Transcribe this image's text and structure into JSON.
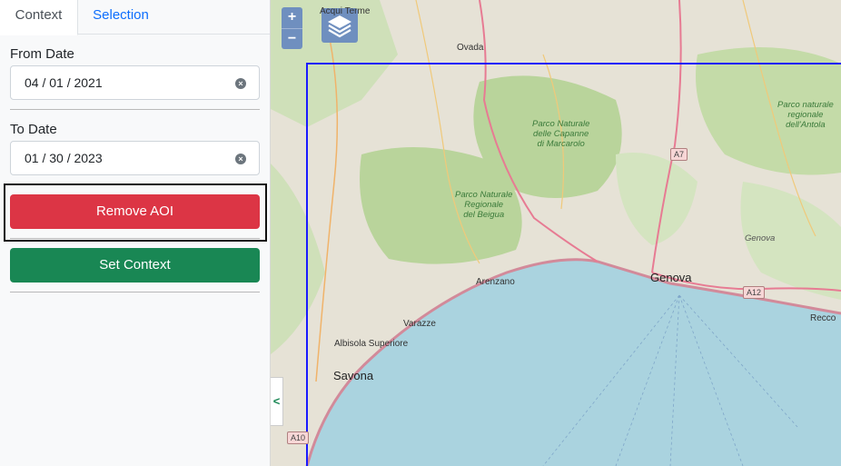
{
  "tabs": [
    {
      "label": "Context",
      "active": true
    },
    {
      "label": "Selection",
      "active": false
    }
  ],
  "from_date": {
    "label": "From Date",
    "value": "04 / 01 / 2021"
  },
  "to_date": {
    "label": "To Date",
    "value": "01 / 30 / 2023"
  },
  "buttons": {
    "remove_aoi": "Remove AOI",
    "set_context": "Set Context"
  },
  "map": {
    "zoom_in": "+",
    "zoom_out": "−",
    "collapse": "<",
    "labels": {
      "acqui_terme": "Acqui Terme",
      "ovada": "Ovada",
      "park_capanne": "Parco Naturale\ndelle Capanne\ndi Marcarolo",
      "park_beigua": "Parco Naturale\nRegionale\ndel Beigua",
      "park_antola": "Parco naturale\nregionale\ndell'Antola",
      "a7": "A7",
      "a12": "A12",
      "a10": "A10",
      "genova_small": "Genova",
      "genova": "Genova",
      "arenzano": "Arenzano",
      "varazze": "Varazze",
      "albisola": "Albisola Superiore",
      "savona": "Savona",
      "recco": "Recco"
    }
  },
  "colors": {
    "danger": "#dc3545",
    "success": "#198754",
    "link": "#0d6efd",
    "aoi_border": "#1a1aff",
    "sea": "#aad3df"
  }
}
